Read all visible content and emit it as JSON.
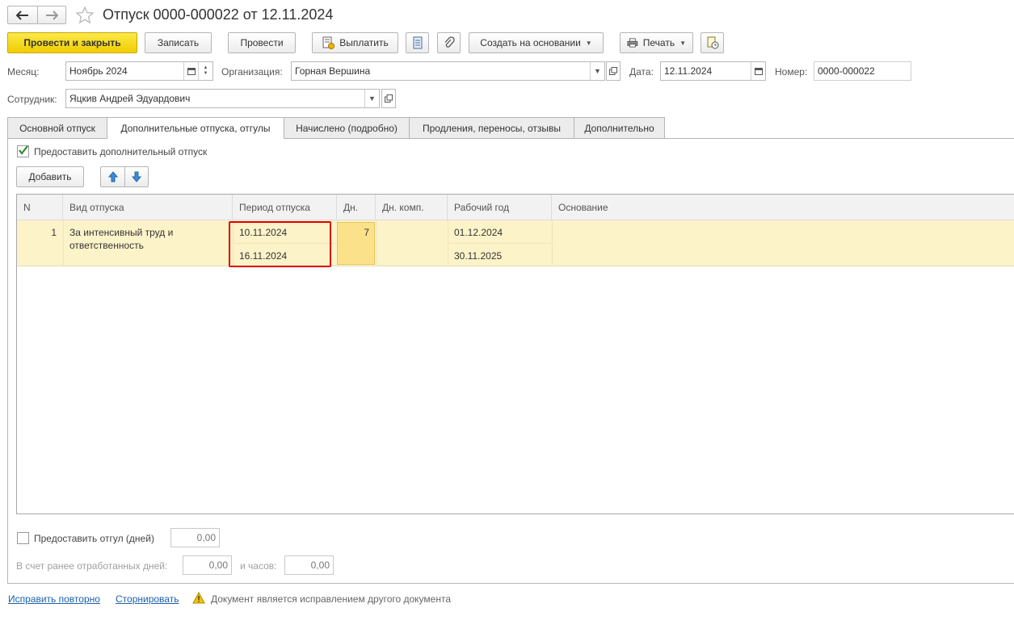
{
  "header": {
    "title": "Отпуск 0000-000022 от 12.11.2024",
    "back_icon": "arrow-left-icon",
    "forward_icon": "arrow-right-icon",
    "favorite_icon": "star-icon"
  },
  "toolbar": {
    "post_close": "Провести и закрыть",
    "save": "Записать",
    "post": "Провести",
    "pay": "Выплатить",
    "create_based": "Создать на основании",
    "print": "Печать"
  },
  "fields": {
    "month_label": "Месяц:",
    "month_value": "Ноябрь 2024",
    "org_label": "Организация:",
    "org_value": "Горная Вершина",
    "date_label": "Дата:",
    "date_value": "12.11.2024",
    "number_label": "Номер:",
    "number_value": "0000-000022",
    "employee_label": "Сотрудник:",
    "employee_value": "Яцкив Андрей Эдуардович"
  },
  "tabs": [
    {
      "label": "Основной отпуск",
      "active": false
    },
    {
      "label": "Дополнительные отпуска, отгулы",
      "active": true
    },
    {
      "label": "Начислено (подробно)",
      "active": false
    },
    {
      "label": "Продления, переносы, отзывы",
      "active": false
    },
    {
      "label": "Дополнительно",
      "active": false
    }
  ],
  "panel": {
    "grant_additional_label": "Предоставить дополнительный отпуск",
    "grant_additional_checked": true,
    "add_button": "Добавить"
  },
  "table": {
    "columns": [
      "N",
      "Вид отпуска",
      "Период отпуска",
      "Дн.",
      "Дн. комп.",
      "Рабочий год",
      "Основание"
    ],
    "rows": [
      {
        "n": "1",
        "kind": "За интенсивный труд и ответственность",
        "period_from": "10.11.2024",
        "period_to": "16.11.2024",
        "days": "7",
        "comp_days": "",
        "work_year_from": "01.12.2024",
        "work_year_to": "30.11.2025",
        "basis": ""
      }
    ]
  },
  "bottom": {
    "grant_dayoff_label": "Предоставить отгул (дней)",
    "grant_dayoff_value": "0,00",
    "earlier_days_label": "В счет ранее отработанных дней:",
    "earlier_days_value": "0,00",
    "hours_label": "и часов:",
    "hours_value": "0,00"
  },
  "footer": {
    "fix_again": "Исправить повторно",
    "reverse": "Сторнировать",
    "notice": "Документ является исправлением другого документа"
  },
  "colors": {
    "primary_button": "#f5d600",
    "selected_row": "#fdf3c9",
    "highlight_border": "#e00000",
    "link": "#1c5faa"
  }
}
